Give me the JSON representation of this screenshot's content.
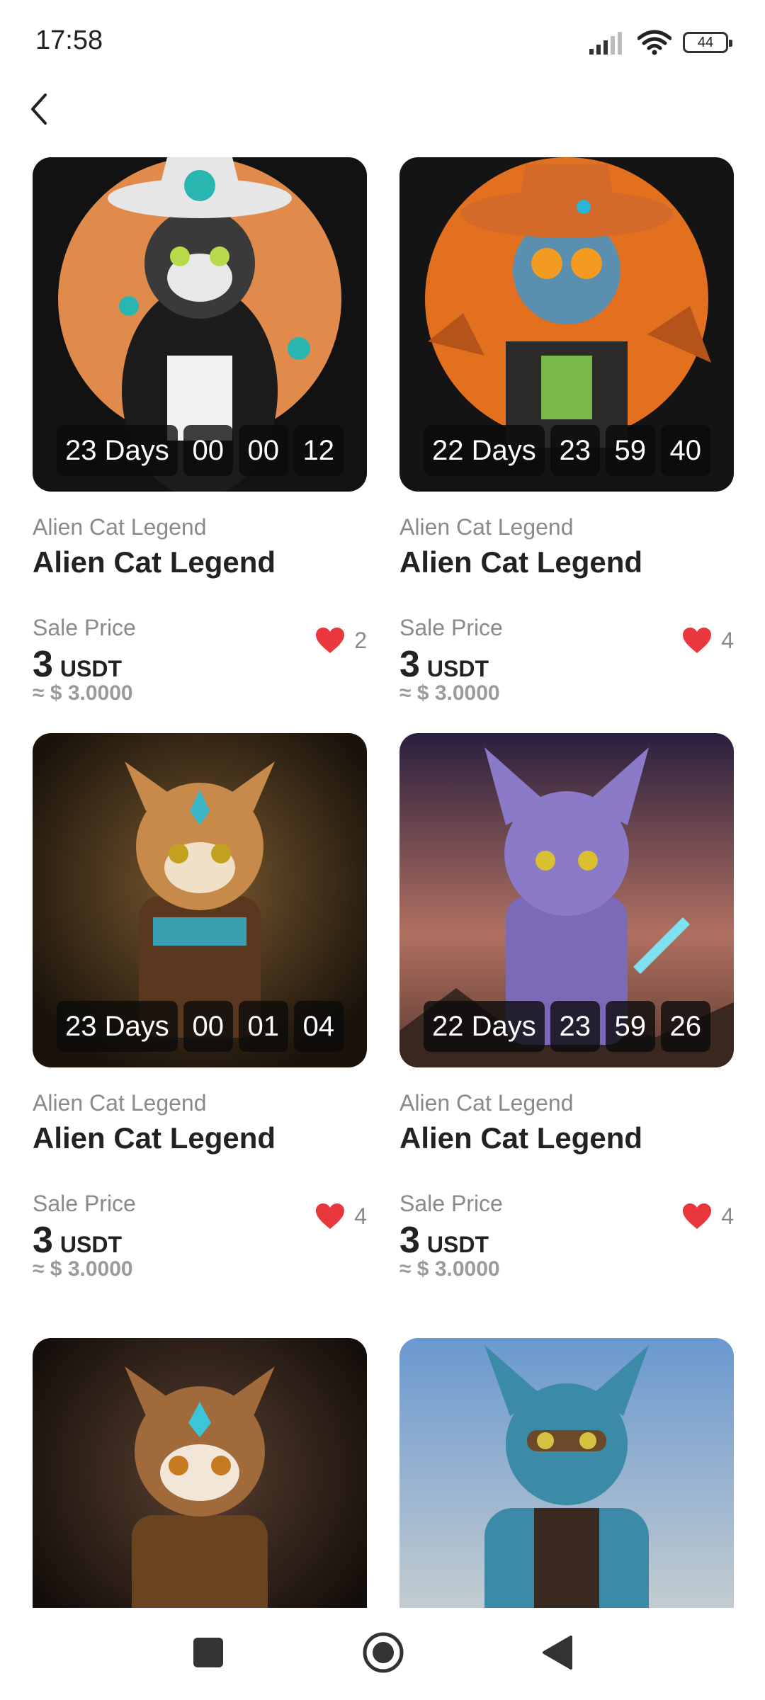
{
  "status_bar": {
    "time": "17:58",
    "battery": "44"
  },
  "header": {
    "back_icon": "chevron-left-icon"
  },
  "cards": [
    {
      "collection": "Alien Cat Legend",
      "title": "Alien Cat Legend",
      "sale_label": "Sale Price",
      "price": "3",
      "unit": "USDT",
      "usd": "≈ $ 3.0000",
      "likes": "2",
      "timer": {
        "days": "23 Days",
        "h": "00",
        "m": "00",
        "s": "12"
      }
    },
    {
      "collection": "Alien Cat Legend",
      "title": "Alien Cat Legend",
      "sale_label": "Sale Price",
      "price": "3",
      "unit": "USDT",
      "usd": "≈ $ 3.0000",
      "likes": "4",
      "timer": {
        "days": "22 Days",
        "h": "23",
        "m": "59",
        "s": "40"
      }
    },
    {
      "collection": "Alien Cat Legend",
      "title": "Alien Cat Legend",
      "sale_label": "Sale Price",
      "price": "3",
      "unit": "USDT",
      "usd": "≈ $ 3.0000",
      "likes": "4",
      "timer": {
        "days": "23 Days",
        "h": "00",
        "m": "01",
        "s": "04"
      }
    },
    {
      "collection": "Alien Cat Legend",
      "title": "Alien Cat Legend",
      "sale_label": "Sale Price",
      "price": "3",
      "unit": "USDT",
      "usd": "≈ $ 3.0000",
      "likes": "4",
      "timer": {
        "days": "22 Days",
        "h": "23",
        "m": "59",
        "s": "26"
      }
    },
    {
      "collection": "",
      "title": "",
      "sale_label": "",
      "price": "",
      "unit": "",
      "usd": "",
      "likes": "",
      "timer": {
        "days": "",
        "h": "",
        "m": "",
        "s": ""
      }
    },
    {
      "collection": "",
      "title": "",
      "sale_label": "",
      "price": "",
      "unit": "",
      "usd": "",
      "likes": "",
      "timer": {
        "days": "",
        "h": "",
        "m": "",
        "s": ""
      }
    }
  ],
  "colors": {
    "heart": "#e8383d",
    "text": "#222222",
    "muted": "#8a8a8a"
  },
  "navbar": {
    "icons": [
      "square-recents-icon",
      "circle-home-icon",
      "triangle-back-icon"
    ]
  }
}
